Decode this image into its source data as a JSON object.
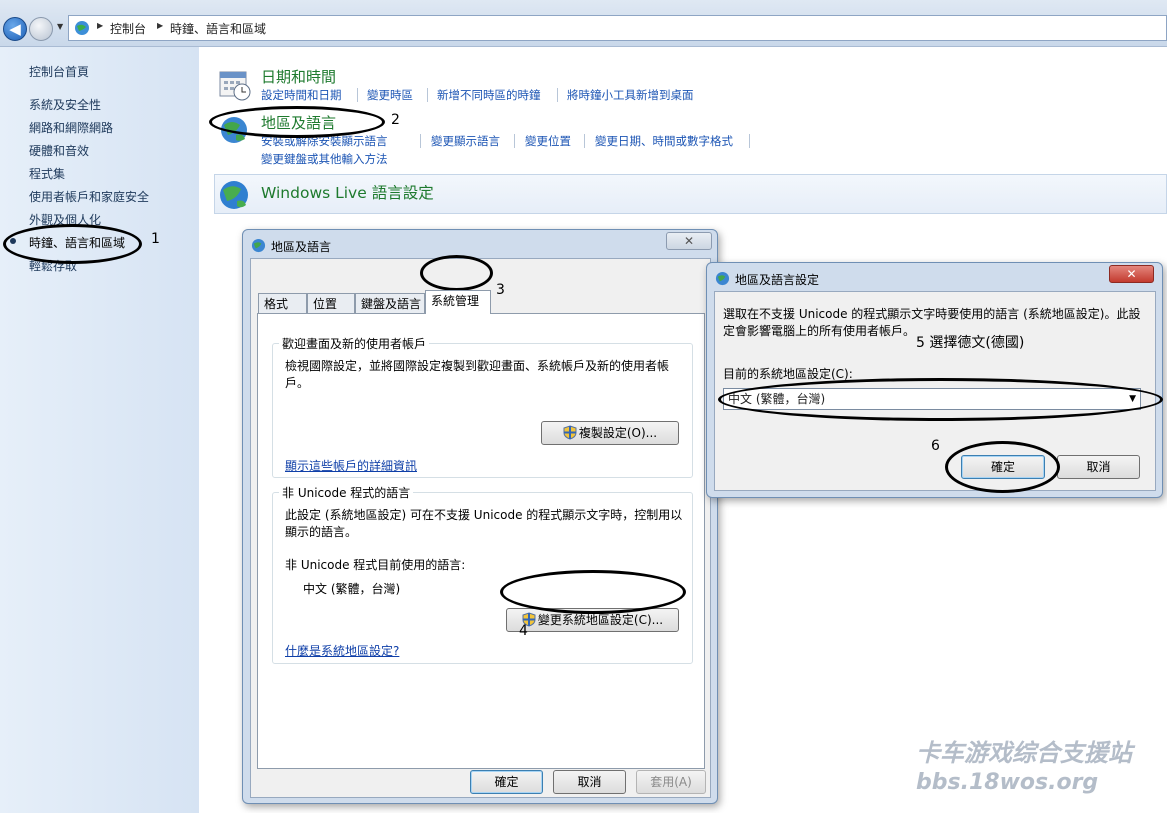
{
  "address_bar": {
    "crumbs": [
      "控制台",
      "時鐘、語言和區域"
    ]
  },
  "sidebar": {
    "home": "控制台首頁",
    "items": [
      "系統及安全性",
      "網路和網際網路",
      "硬體和音效",
      "程式集",
      "使用者帳戶和家庭安全",
      "外觀及個人化",
      "時鐘、語言和區域",
      "輕鬆存取"
    ],
    "selected": "時鐘、語言和區域"
  },
  "categories": {
    "datetime": {
      "title": "日期和時間",
      "links": [
        "設定時間和日期",
        "變更時區",
        "新增不同時區的時鐘",
        "將時鐘小工具新增到桌面"
      ]
    },
    "region": {
      "title": "地區及語言",
      "links": [
        "安裝或解除安裝顯示語言",
        "變更顯示語言",
        "變更位置",
        "變更日期、時間或數字格式",
        "變更鍵盤或其他輸入方法"
      ]
    },
    "windows_live": {
      "title": "Windows Live 語言設定"
    }
  },
  "dialog_region": {
    "title": "地區及語言",
    "close": "✕",
    "tabs": [
      "格式",
      "位置",
      "鍵盤及語言",
      "系統管理"
    ],
    "active_tab": "系統管理",
    "welcome_group": {
      "title": "歡迎畫面及新的使用者帳戶",
      "text": "檢視國際設定，並將國際設定複製到歡迎畫面、系統帳戶及新的使用者帳戶。",
      "copy_button": "複製設定(O)...",
      "details_link": "顯示這些帳戶的詳細資訊"
    },
    "unicode_group": {
      "title": "非 Unicode 程式的語言",
      "text": "此設定 (系統地區設定) 可在不支援 Unicode 的程式顯示文字時，控制用以顯示的語言。",
      "current_label": "非 Unicode 程式目前使用的語言:",
      "current_value": "中文 (繁體，台灣)",
      "change_button": "變更系統地區設定(C)...",
      "help_link": "什麼是系統地區設定?"
    },
    "buttons": {
      "ok": "確定",
      "cancel": "取消",
      "apply": "套用(A)"
    }
  },
  "dialog_locale": {
    "title": "地區及語言設定",
    "close": "✕",
    "description": "選取在不支援 Unicode 的程式顯示文字時要使用的語言 (系統地區設定)。此設定會影響電腦上的所有使用者帳戶。",
    "current_label": "目前的系統地區設定(C):",
    "selected_locale": "中文 (繁體，台灣)",
    "buttons": {
      "ok": "確定",
      "cancel": "取消"
    }
  },
  "annotations": {
    "n1": "1",
    "n2": "2",
    "n3": "3",
    "n4": "4",
    "n5": "5 選擇德文(德國)",
    "n6": "6"
  },
  "watermark": {
    "line1": "卡车游戏综合支援站",
    "line2": "bbs.18wos.org"
  },
  "colors": {
    "sidebar_bg": "#d6e3f3",
    "category_title": "#1e7a2e",
    "link": "#1c55b4",
    "close_button": "#c9463d"
  }
}
